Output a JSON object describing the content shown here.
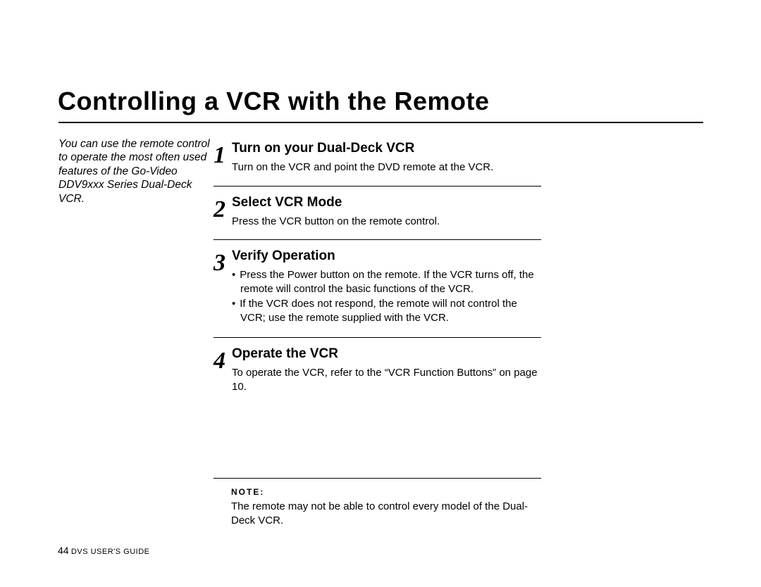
{
  "title": "Controlling a VCR with the Remote",
  "intro": "You can use the remote control to operate the most often used features of the Go-Video DDV9xxx Series Dual-Deck VCR.",
  "steps": [
    {
      "num": "1",
      "head": "Turn on your Dual-Deck VCR",
      "text": "Turn on the VCR and point the DVD remote at the VCR."
    },
    {
      "num": "2",
      "head": "Select VCR Mode",
      "text": "Press the VCR button on the remote control."
    },
    {
      "num": "3",
      "head": "Verify Operation",
      "bullets": [
        "Press the Power button on the remote. If the VCR turns off, the remote will control the basic functions of the VCR.",
        "If the VCR does not respond, the remote will not control the VCR; use the remote supplied with the VCR."
      ]
    },
    {
      "num": "4",
      "head": "Operate the VCR",
      "text": "To operate the VCR, refer to the “VCR Function Buttons” on page 10."
    }
  ],
  "note_label": "NOTE:",
  "note_text": "The remote may not be able to control every model of the Dual-Deck VCR.",
  "footer_page": "44",
  "footer_guide": "DVS USER'S GUIDE"
}
